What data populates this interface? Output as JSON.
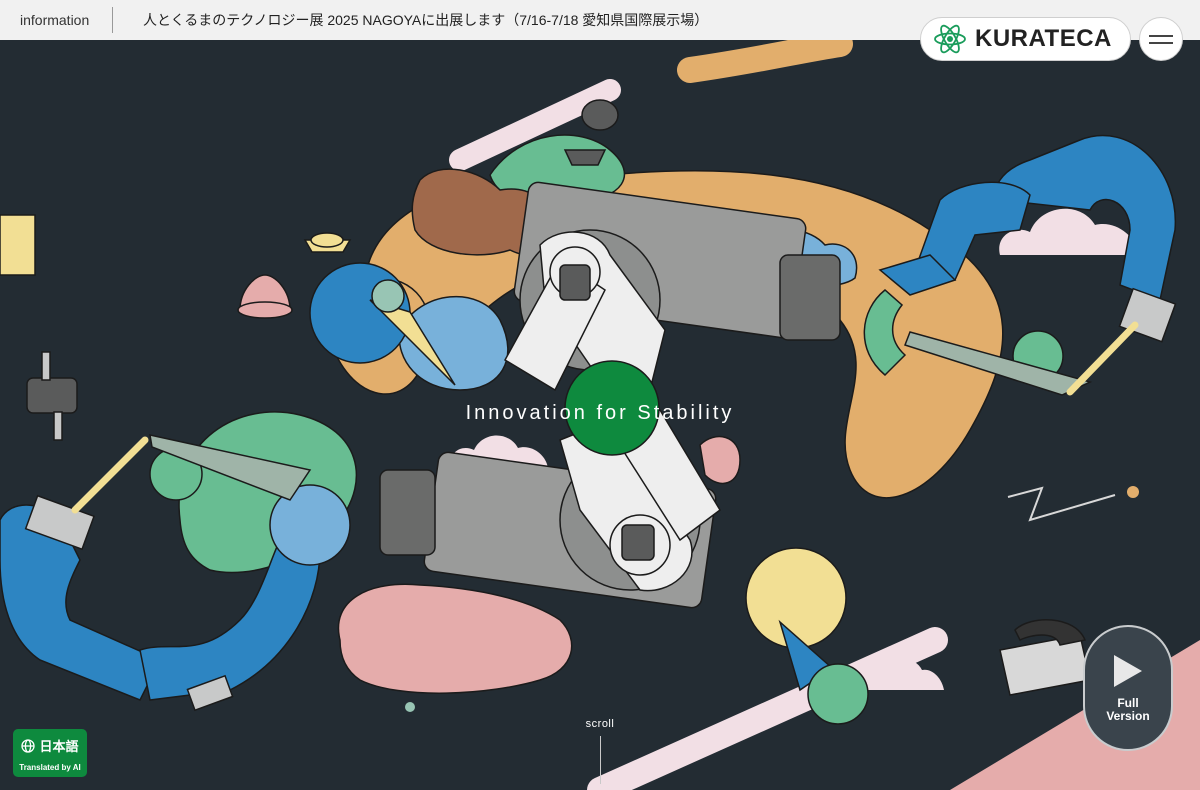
{
  "info_bar": {
    "label": "information",
    "text": "人とくるまのテクノロジー展 2025 NAGOYAに出展します（7/16-7/18 愛知県国際展示場）"
  },
  "header": {
    "logo_text": "KURATECA",
    "logo_icon": "atom-icon",
    "menu_icon": "hamburger-icon"
  },
  "hero": {
    "tagline": "Innovation for Stability"
  },
  "scroll": {
    "label": "scroll"
  },
  "language_button": {
    "label": "日本語",
    "sublabel": "Translated by AI",
    "icon": "globe-icon"
  },
  "full_version_button": {
    "label": "Full\nVersion",
    "icon": "play-icon"
  },
  "colors": {
    "background": "#232c33",
    "info_bar": "#f1f1f1",
    "brand_green": "#0e8a3e",
    "blue": "#2d85c2",
    "orange": "#e2ae6c",
    "pink": "#e5acab",
    "mint": "#68bd92",
    "gray": "#8d8f8e"
  }
}
